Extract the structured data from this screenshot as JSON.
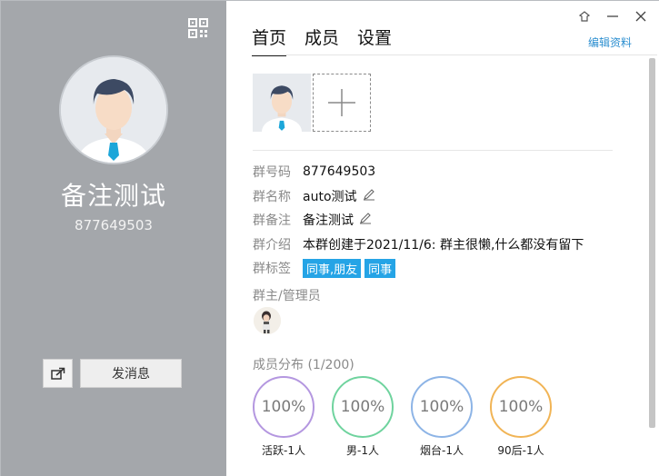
{
  "left_panel": {
    "group_name": "备注测试",
    "group_id": "877649503",
    "send_message_label": "发消息"
  },
  "tabs": [
    {
      "label": "首页",
      "active": true
    },
    {
      "label": "成员",
      "active": false
    },
    {
      "label": "设置",
      "active": false
    }
  ],
  "edit_profile_label": "编辑资料",
  "info": {
    "group_number": {
      "label": "群号码",
      "value": "877649503"
    },
    "group_name": {
      "label": "群名称",
      "value": "auto测试"
    },
    "group_remark": {
      "label": "群备注",
      "value": "备注测试"
    },
    "group_intro": {
      "label": "群介绍",
      "value": "本群创建于2021/11/6:  群主很懒,什么都没有留下"
    },
    "group_tags": {
      "label": "群标签",
      "tags": [
        "同事,朋友",
        "同事"
      ]
    }
  },
  "admins_label": "群主/管理员",
  "distribution": {
    "label": "成员分布 (1/200)",
    "items": [
      {
        "percent": "100%",
        "label": "活跃-1人",
        "color": "#b497e0"
      },
      {
        "percent": "100%",
        "label": "男-1人",
        "color": "#6fd39e"
      },
      {
        "percent": "100%",
        "label": "烟台-1人",
        "color": "#8db4e6"
      },
      {
        "percent": "100%",
        "label": "90后-1人",
        "color": "#f1b455"
      }
    ]
  },
  "colors": {
    "left_bg": "#a4a7ab",
    "accent": "#25a4e6",
    "link": "#2d8fd0"
  }
}
